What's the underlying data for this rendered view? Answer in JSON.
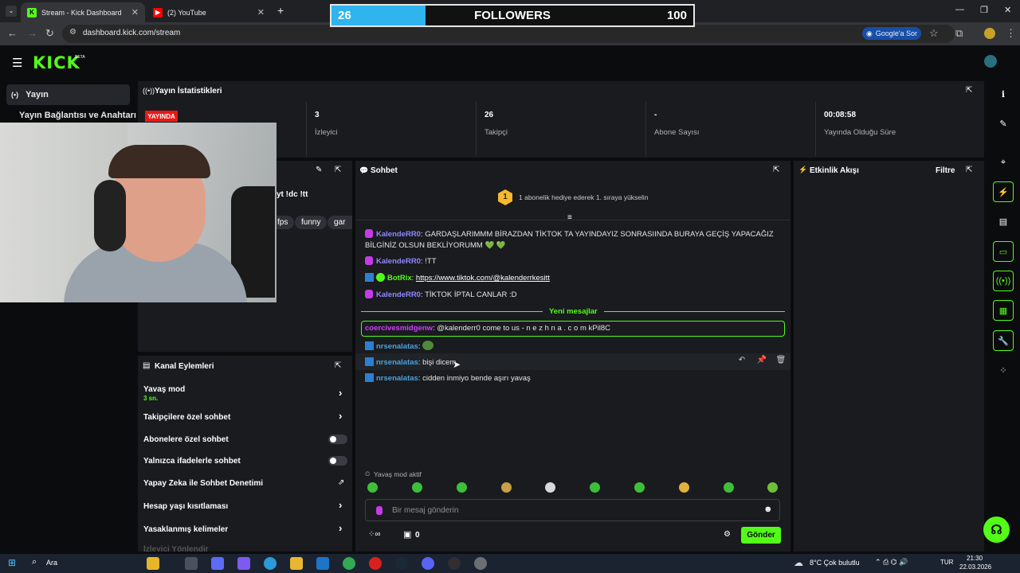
{
  "browser": {
    "tabs": [
      {
        "title": "Stream - Kick Dashboard",
        "active": true
      },
      {
        "title": "(2) YouTube",
        "active": false
      }
    ],
    "url": "dashboard.kick.com/stream",
    "google_ask": "Google'a Sor"
  },
  "overlay": {
    "current": "26",
    "label": "FOLLOWERS",
    "goal": "100",
    "progress_fraction": 0.26
  },
  "brand": {
    "logo": "KICK",
    "beta": "BETA"
  },
  "leftnav": {
    "active": "Yayın",
    "item2": "Yayın Bağlantısı ve Anahtarı"
  },
  "stats": {
    "title": "Yayın İstatistikleri",
    "live_badge": "YAYINDA",
    "items": [
      {
        "value": "3",
        "label": "İzleyici"
      },
      {
        "value": "26",
        "label": "Takipçi"
      },
      {
        "value": "-",
        "label": "Abone Sayısı"
      },
      {
        "value": "00:08:58",
        "label": "Yayında Olduğu Süre"
      }
    ]
  },
  "stream_info": {
    "title_partial": "yt !dc !tt",
    "tags": [
      "fps",
      "funny",
      "gar"
    ]
  },
  "channel_actions": {
    "title": "Kanal Eylemleri",
    "slow_mode": "Yavaş mod",
    "slow_mode_value": "3 sn.",
    "followers_only": "Takipçilere özel sohbet",
    "subs_only": "Abonelere özel sohbet",
    "emotes_only": "Yalnızca ifadelerle sohbet",
    "ai_moderation": "Yapay Zeka ile Sohbet Denetimi",
    "account_age": "Hesap yaşı kısıtlaması",
    "banned_words": "Yasaklanmış kelimeler",
    "cut_off": "İzleyici Yönlendir"
  },
  "chat": {
    "title": "Sohbet",
    "gift_rank": "1",
    "gift_prompt": "1 abonelik hediye ederek 1. sıraya yükselin",
    "messages": [
      {
        "user": "KalendeRR0",
        "text": "GARDAŞLARIMMM BİRAZDAN TİKTOK TA YAYINDAYIZ SONRASIINDA BURAYA GEÇİŞ YAPACAĞIZ BİLGİNİZ OLSUN BEKLİYORUMM 💚 💚"
      },
      {
        "user": "KalendeRR0",
        "text": "!TT"
      },
      {
        "user": "BotRix",
        "text": "https://www.tiktok.com/@kalenderrkesitt"
      },
      {
        "user": "KalendeRR0",
        "text": "TİKTOK İPTAL CANLAR :D"
      }
    ],
    "new_messages_label": "Yeni mesajlar",
    "highlighted": {
      "user": "coercivesmidgenw",
      "text": "@kalenderr0 come to us - n e z h n a . c o m kPil8C"
    },
    "new_messages": [
      {
        "user": "nrsenalatas",
        "text": ""
      },
      {
        "user": "nrsenalatas",
        "text": "bişi dicem"
      },
      {
        "user": "nrsenalatas",
        "text": "cidden inmiyo bende aşırı yavaş"
      }
    ],
    "slow_mode_notice": "Yavaş mod aktif",
    "input_placeholder": "Bir mesaj gönderin",
    "points": "0",
    "send_label": "Gönder"
  },
  "activity": {
    "title": "Etkinlik Akışı",
    "filter": "Filtre"
  },
  "taskbar": {
    "search": "Ara",
    "weather": "8°C  Çok bulutlu",
    "lang": "TUR",
    "time": "21:30",
    "date": "22.03.2026"
  },
  "colors": {
    "kick_green": "#53fc18",
    "live_red": "#e91916",
    "overlay_blue": "#2fb4ee"
  }
}
